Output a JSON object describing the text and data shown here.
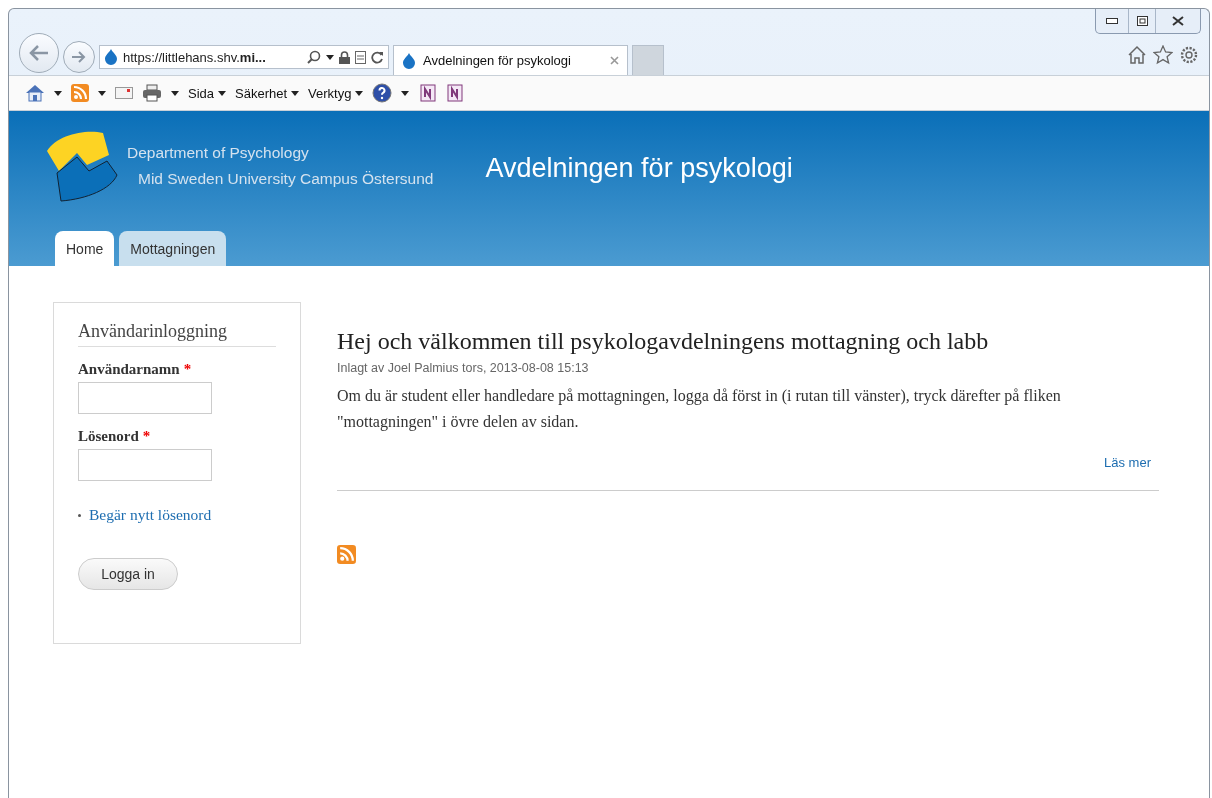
{
  "browser": {
    "address": "https://littlehans.shv.**mi...**",
    "tabs": [
      {
        "label": "Avdelningen för psykologi",
        "selected": true
      }
    ],
    "command_bar": [
      "Sida",
      "Säkerhet",
      "Verktyg"
    ]
  },
  "site": {
    "department": "Department of Psychology",
    "university": "Mid Sweden University Campus Östersund",
    "title": "Avdelningen för psykologi",
    "nav": [
      {
        "label": "Home",
        "selected": true
      },
      {
        "label": "Mottagningen",
        "selected": false
      }
    ]
  },
  "login": {
    "title": "Användarinloggning",
    "fields": [
      {
        "label": "Användarnamn",
        "required_mark": "*"
      },
      {
        "label": "Lösenord",
        "required_mark": "*"
      }
    ],
    "links": [
      "Begär nytt lösenord"
    ],
    "button": "Logga in"
  },
  "article": {
    "title": "Hej och välkommen till psykologavdelningens mottagning och labb",
    "meta": "Inlagt av Joel Palmius tors, 2013-08-08 15:13",
    "body": "Om du är student eller handledare på mottagningen, logga då först in (i rutan till vänster), tryck därefter på fliken \"mottagningen\" i övre delen av sidan.",
    "read_more": "Läs mer"
  }
}
